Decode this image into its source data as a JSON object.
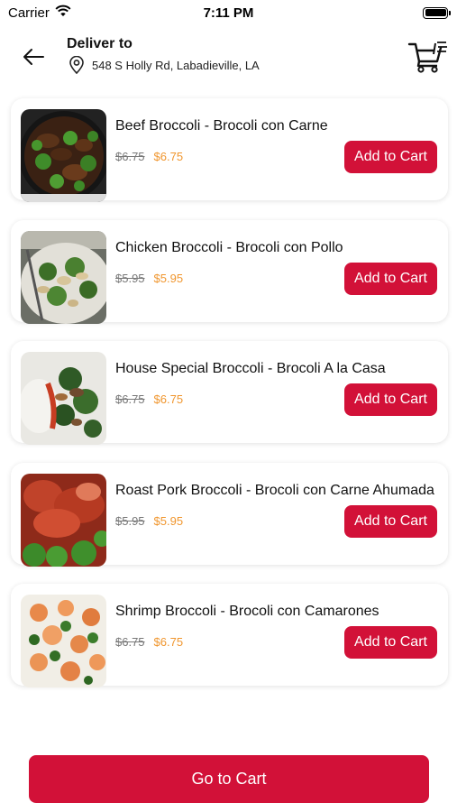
{
  "status_bar": {
    "carrier": "Carrier",
    "time": "7:11 PM"
  },
  "header": {
    "title": "Deliver to",
    "address": "548 S Holly Rd, Labadieville, LA",
    "back_icon": "arrow-left-icon",
    "pin_icon": "location-pin-icon",
    "cart_icon": "shopping-cart-icon"
  },
  "colors": {
    "accent": "#d21138",
    "sale_price": "#f0962e"
  },
  "items": [
    {
      "name": "Beef Broccoli - Brocoli con Carne",
      "old_price": "$6.75",
      "price": "$6.75",
      "button": "Add to Cart"
    },
    {
      "name": "Chicken Broccoli - Brocoli con Pollo",
      "old_price": "$5.95",
      "price": "$5.95",
      "button": "Add to Cart"
    },
    {
      "name": "House Special Broccoli - Brocoli A la Casa",
      "old_price": "$6.75",
      "price": "$6.75",
      "button": "Add to Cart"
    },
    {
      "name": "Roast Pork Broccoli - Brocoli con Carne Ahumada",
      "old_price": "$5.95",
      "price": "$5.95",
      "button": "Add to Cart"
    },
    {
      "name": "Shrimp Broccoli - Brocoli con Camarones",
      "old_price": "$6.75",
      "price": "$6.75",
      "button": "Add to Cart"
    }
  ],
  "footer": {
    "go_to_cart": "Go to Cart"
  }
}
